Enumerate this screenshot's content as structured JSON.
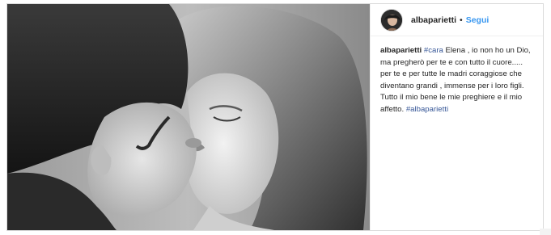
{
  "post": {
    "username": "albaparietti",
    "separator": "•",
    "follow_label": "Segui",
    "caption": {
      "username": "albaparietti",
      "hashtag_start": "#cara",
      "text": " Elena , io non ho un Dio,\nma pregherò per te e con tutto il cuore.....\nper te e per tutte le madri coraggiose che\ndiventano grandi , immense per i loro figli.\nTutto il mio bene le mie preghiere e il mio\naffetto. ",
      "hashtag_end": "#albaparietti"
    }
  },
  "icons": {
    "avatar": "profile-avatar",
    "photo": "post-photo"
  }
}
